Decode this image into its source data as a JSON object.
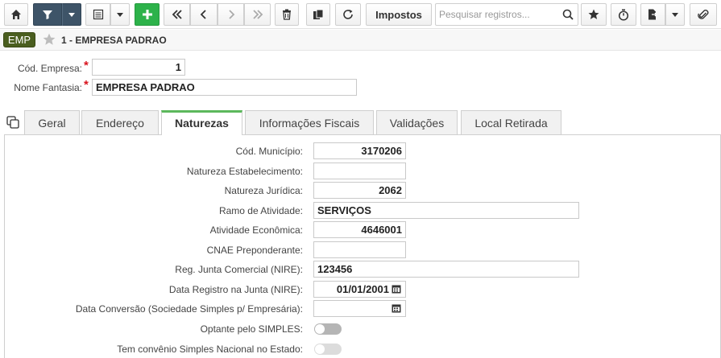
{
  "toolbar": {
    "home_icon": "home-icon",
    "filter_icon": "filter-icon",
    "impostos_label": "Impostos",
    "search_placeholder": "Pesquisar registros...",
    "search_value": ""
  },
  "titlebar": {
    "badge": "EMP",
    "title": "1 - EMPRESA PADRAO"
  },
  "header": {
    "cod_empresa_label": "Cód. Empresa:",
    "cod_empresa_value": "1",
    "nome_fantasia_label": "Nome Fantasia:",
    "nome_fantasia_value": "EMPRESA PADRAO"
  },
  "tabs": [
    {
      "label": "Geral"
    },
    {
      "label": "Endereço"
    },
    {
      "label": "Naturezas"
    },
    {
      "label": "Informações Fiscais"
    },
    {
      "label": "Validações"
    },
    {
      "label": "Local Retirada"
    }
  ],
  "form": {
    "cod_municipio_label": "Cód. Município:",
    "cod_municipio_value": "3170206",
    "natureza_estab_label": "Natureza Estabelecimento:",
    "natureza_estab_value": "",
    "natureza_juridica_label": "Natureza Jurídica:",
    "natureza_juridica_value": "2062",
    "ramo_label": "Ramo de Atividade:",
    "ramo_value": "SERVIÇOS",
    "atividade_label": "Atividade Econômica:",
    "atividade_value": "4646001",
    "cnae_label": "CNAE Preponderante:",
    "cnae_value": "",
    "nire_label": "Reg. Junta Comercial (NIRE):",
    "nire_value": "123456",
    "data_registro_label": "Data Registro na Junta (NIRE):",
    "data_registro_value": "01/01/2001",
    "data_conversao_label": "Data Conversão (Sociedade Simples p/ Empresária):",
    "data_conversao_value": "",
    "simples_label": "Optante pelo SIMPLES:",
    "simples_on": false,
    "convenio_label": "Tem convênio Simples Nacional no Estado:",
    "convenio_on": false
  }
}
